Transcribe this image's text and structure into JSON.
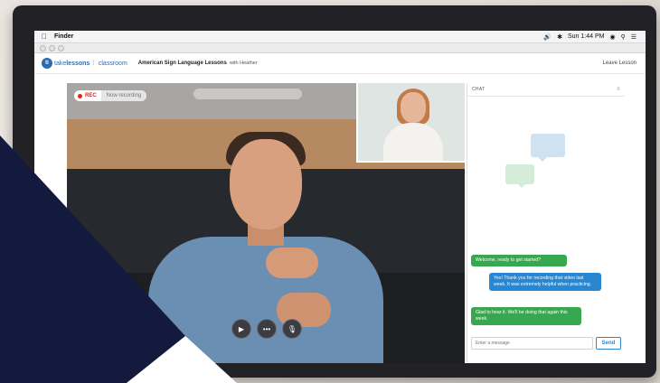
{
  "menubar": {
    "apple_icon": "apple-icon",
    "app_name": "Finder",
    "status": "Sun 1:44 PM"
  },
  "app": {
    "brand_prefix": "take",
    "brand_name": "lessons",
    "brand_suffix": "classroom",
    "lesson_title": "American Sign Language Lessons",
    "lesson_with": "with Heather",
    "leave_label": "Leave Lesson"
  },
  "video": {
    "rec_label": "REC",
    "rec_state": "Now recording"
  },
  "chat": {
    "header": "CHAT",
    "messages": [
      {
        "side": "teacher",
        "text": "Welcome, ready to get started?"
      },
      {
        "side": "student",
        "text": "Yes! Thank you for recording that video last week. It was extremely helpful when practicing."
      },
      {
        "side": "teacher",
        "text": "Glad to hear it. We'll be doing that again this week."
      }
    ],
    "input_placeholder": "Enter a message",
    "send_label": "Send"
  },
  "colors": {
    "accent_blue": "#2a86cf",
    "accent_green": "#37a84f",
    "rec_red": "#e02424",
    "corner_navy": "#131a3d"
  }
}
